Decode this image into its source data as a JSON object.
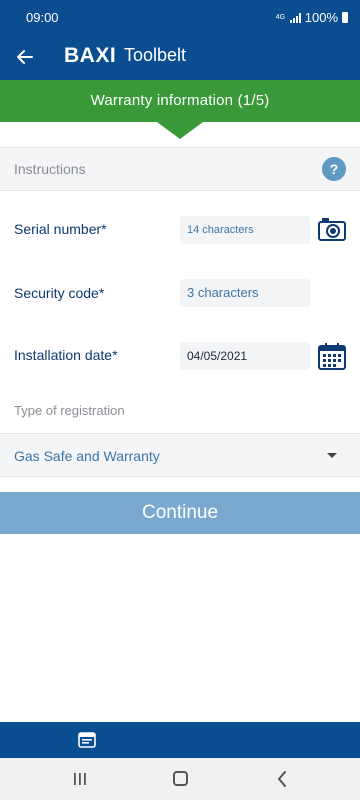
{
  "status_bar": {
    "time": "09:00",
    "network": "4G",
    "battery": "100%"
  },
  "app_bar": {
    "brand": "BAXI",
    "title": "Toolbelt"
  },
  "banner": {
    "title": "Warranty information (1/5)"
  },
  "instructions": {
    "label": "Instructions",
    "help": "?"
  },
  "fields": {
    "serial_number": {
      "label": "Serial number*",
      "placeholder": "14 characters"
    },
    "security_code": {
      "label": "Security code*",
      "placeholder": "3 characters"
    },
    "installation_date": {
      "label": "Installation date*",
      "value": "04/05/2021"
    }
  },
  "registration": {
    "label": "Type of registration",
    "selected": "Gas Safe and Warranty"
  },
  "actions": {
    "continue_label": "Continue"
  },
  "colors": {
    "primary": "#0a4d91",
    "banner_green": "#3a9a39",
    "button": "#7aa8cf",
    "label_text": "#0d3a73",
    "link_text": "#3c76a8"
  },
  "icons": [
    "back-arrow-icon",
    "help-icon",
    "camera-icon",
    "calendar-icon",
    "chevron-down-icon",
    "id-card-icon",
    "recents-icon",
    "home-icon",
    "back-icon"
  ]
}
